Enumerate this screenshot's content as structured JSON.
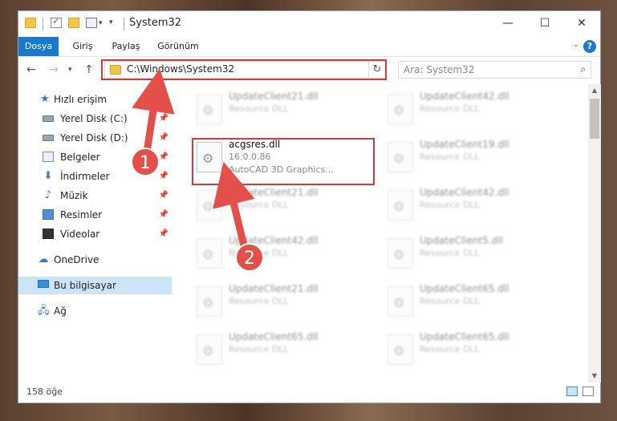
{
  "window": {
    "title": "System32",
    "controls": {
      "minimize": "—",
      "maximize": "☐",
      "close": "✕"
    }
  },
  "ribbon": {
    "tabs": [
      {
        "label": "Dosya",
        "active": true
      },
      {
        "label": "Giriş"
      },
      {
        "label": "Paylaş"
      },
      {
        "label": "Görünüm"
      }
    ],
    "help_label": "?"
  },
  "navbar": {
    "address": "C:\\Windows\\System32",
    "search_placeholder": "Ara: System32"
  },
  "navpane": {
    "items": [
      {
        "label": "Hızlı erişim",
        "icon": "star-icon"
      },
      {
        "label": "Yerel Disk (C:)",
        "icon": "drive-icon",
        "pinned": true
      },
      {
        "label": "Yerel Disk (D:)",
        "icon": "drive-icon",
        "pinned": true
      },
      {
        "label": "Belgeler",
        "icon": "documents-icon",
        "pinned": true
      },
      {
        "label": "İndirmeler",
        "icon": "downloads-icon",
        "pinned": true
      },
      {
        "label": "Müzik",
        "icon": "music-icon",
        "pinned": true
      },
      {
        "label": "Resimler",
        "icon": "pictures-icon",
        "pinned": true
      },
      {
        "label": "Videolar",
        "icon": "videos-icon",
        "pinned": true
      },
      {
        "label": "OneDrive",
        "icon": "cloud-icon"
      },
      {
        "label": "Bu bilgisayar",
        "icon": "computer-icon",
        "selected": true
      },
      {
        "label": "Ağ",
        "icon": "network-icon"
      }
    ]
  },
  "files": [
    {
      "name": "UpdateClient21.dll",
      "type": "Resource DLL",
      "blurred": true
    },
    {
      "name": "UpdateClient42.dll",
      "type": "Resource DLL",
      "blurred": true
    },
    {
      "name": "acgsres.dll",
      "type": "16.0.0.86",
      "description": "AutoCAD 3D Graphics...",
      "highlighted": true
    },
    {
      "name": "UpdateClient19.dll",
      "type": "Resource DLL",
      "blurred": true
    },
    {
      "name": "UpdateClient21.dll",
      "type": "Resource DLL",
      "blurred": true
    },
    {
      "name": "UpdateClient42.dll",
      "type": "Resource DLL",
      "blurred": true
    },
    {
      "name": "UpdateClient42.dll",
      "type": "Resource DLL",
      "blurred": true
    },
    {
      "name": "UpdateClient5.dll",
      "type": "Resource DLL",
      "blurred": true
    },
    {
      "name": "UpdateClient21.dll",
      "type": "Resource DLL",
      "blurred": true
    },
    {
      "name": "UpdateClient65.dll",
      "type": "Resource DLL",
      "blurred": true
    },
    {
      "name": "UpdateClient65.dll",
      "type": "Resource DLL",
      "blurred": true
    },
    {
      "name": "UpdateClient65.dll",
      "type": "Resource DLL",
      "blurred": true
    }
  ],
  "status": {
    "item_count": "158 öğe"
  },
  "annotations": {
    "marker1": "1",
    "marker2": "2",
    "color": "#e3504a"
  }
}
